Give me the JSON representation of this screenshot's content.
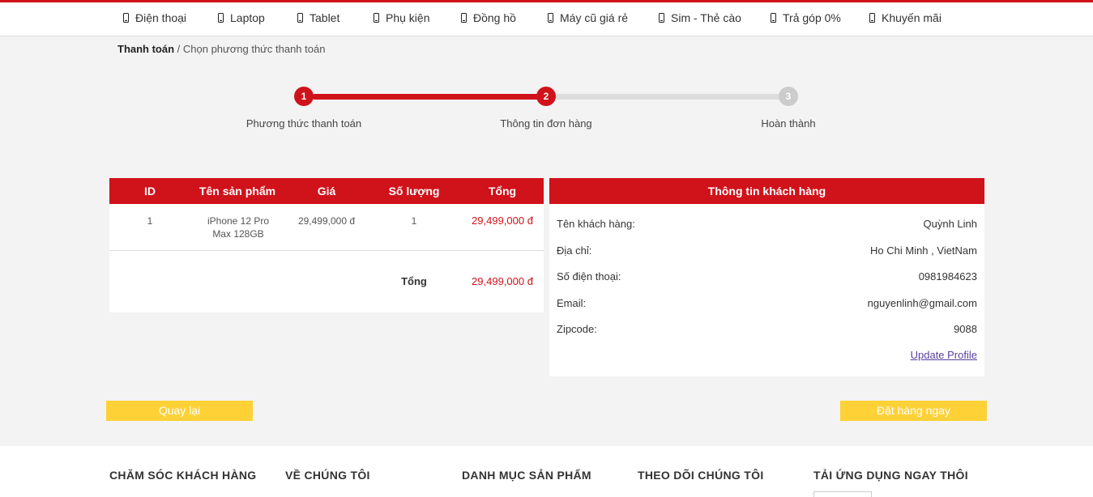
{
  "nav": {
    "items": [
      {
        "label": "Điện thoại",
        "icon": "phone-icon"
      },
      {
        "label": "Laptop",
        "icon": "phone-icon"
      },
      {
        "label": "Tablet",
        "icon": "phone-icon"
      },
      {
        "label": "Phụ kiện",
        "icon": "phone-icon"
      },
      {
        "label": "Đồng hồ",
        "icon": "phone-icon"
      },
      {
        "label": "Máy cũ giá rẻ",
        "icon": "phone-icon"
      },
      {
        "label": "Sim - Thẻ cào",
        "icon": "phone-icon"
      },
      {
        "label": "Trả góp 0%",
        "icon": "phone-icon"
      },
      {
        "label": "Khuyến mãi",
        "icon": "phone-icon"
      }
    ]
  },
  "breadcrumb": {
    "current": "Thanh toán",
    "separator": " / ",
    "sub": "Chọn phương thức thanh toán"
  },
  "steps": {
    "items": [
      {
        "number": "1",
        "label": "Phương thức thanh toán",
        "state": "done"
      },
      {
        "number": "2",
        "label": "Thông tin đơn hàng",
        "state": "active"
      },
      {
        "number": "3",
        "label": "Hoàn thành",
        "state": "pending"
      }
    ],
    "active_color": "#d0121a",
    "inactive_color": "#cccccc"
  },
  "order": {
    "headers": {
      "id": "ID",
      "name": "Tên sản phẩm",
      "price": "Giá",
      "qty": "Số lượng",
      "total": "Tổng"
    },
    "rows": [
      {
        "id": "1",
        "name_line1": "iPhone 12 Pro",
        "name_line2": "Max 128GB",
        "price": "29,499,000 đ",
        "qty": "1",
        "total": "29,499,000 đ"
      }
    ],
    "total_label": "Tổng",
    "total_value": "29,499,000 đ"
  },
  "customer": {
    "title": "Thông tin khách hàng",
    "fields": [
      {
        "label": "Tên khách hàng:",
        "value": "Quỳnh Linh"
      },
      {
        "label": "Địa chỉ:",
        "value": "Ho Chi Minh , VietNam"
      },
      {
        "label": "Số điện thoại:",
        "value": "0981984623"
      },
      {
        "label": "Email:",
        "value": "nguyenlinh@gmail.com"
      },
      {
        "label": "Zipcode:",
        "value": "9088"
      }
    ],
    "update_link": "Update Profile"
  },
  "actions": {
    "back_label": "Quay lại",
    "order_label": "Đặt hàng ngay"
  },
  "footer": {
    "sections": [
      "CHĂM SÓC KHÁCH HÀNG",
      "VỀ CHÚNG TÔI",
      "DANH MỤC SẢN PHẨM",
      "THEO DÕI CHÚNG TÔI",
      "TẢI ỨNG DỤNG NGAY THÔI"
    ]
  },
  "colors": {
    "brand_red": "#d0121a",
    "button_yellow": "#fed136",
    "link_purple": "#5a3f9c"
  }
}
